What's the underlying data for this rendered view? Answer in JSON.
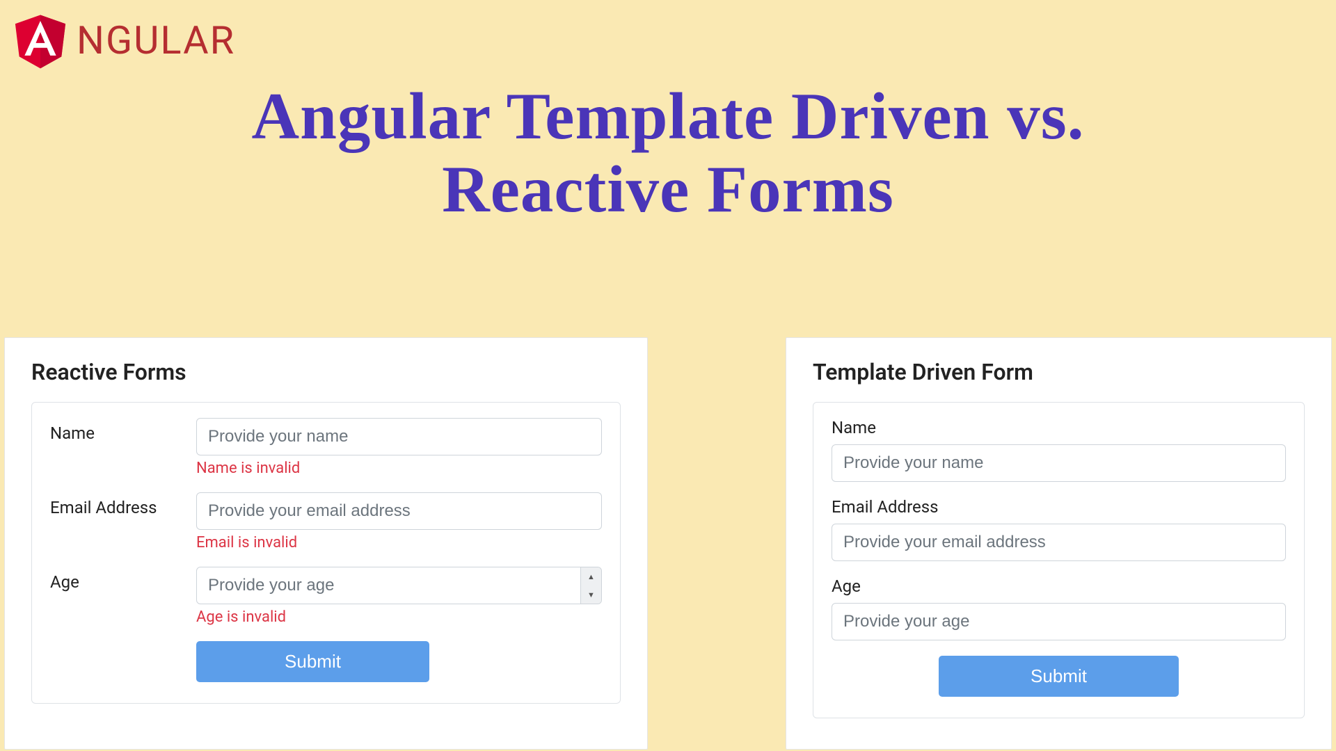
{
  "logo": {
    "text": "NGULAR",
    "letter": "A"
  },
  "title": {
    "line1": "Angular Template Driven vs.",
    "line2": "Reactive Forms"
  },
  "reactive": {
    "title": "Reactive Forms",
    "name": {
      "label": "Name",
      "placeholder": "Provide your name",
      "error": "Name is invalid"
    },
    "email": {
      "label": "Email Address",
      "placeholder": "Provide your email address",
      "error": "Email is invalid"
    },
    "age": {
      "label": "Age",
      "placeholder": "Provide your age",
      "error": "Age is invalid"
    },
    "submit": "Submit"
  },
  "template": {
    "title": "Template Driven Form",
    "name": {
      "label": "Name",
      "placeholder": "Provide your name"
    },
    "email": {
      "label": "Email Address",
      "placeholder": "Provide your email address"
    },
    "age": {
      "label": "Age",
      "placeholder": "Provide your age"
    },
    "submit": "Submit"
  }
}
